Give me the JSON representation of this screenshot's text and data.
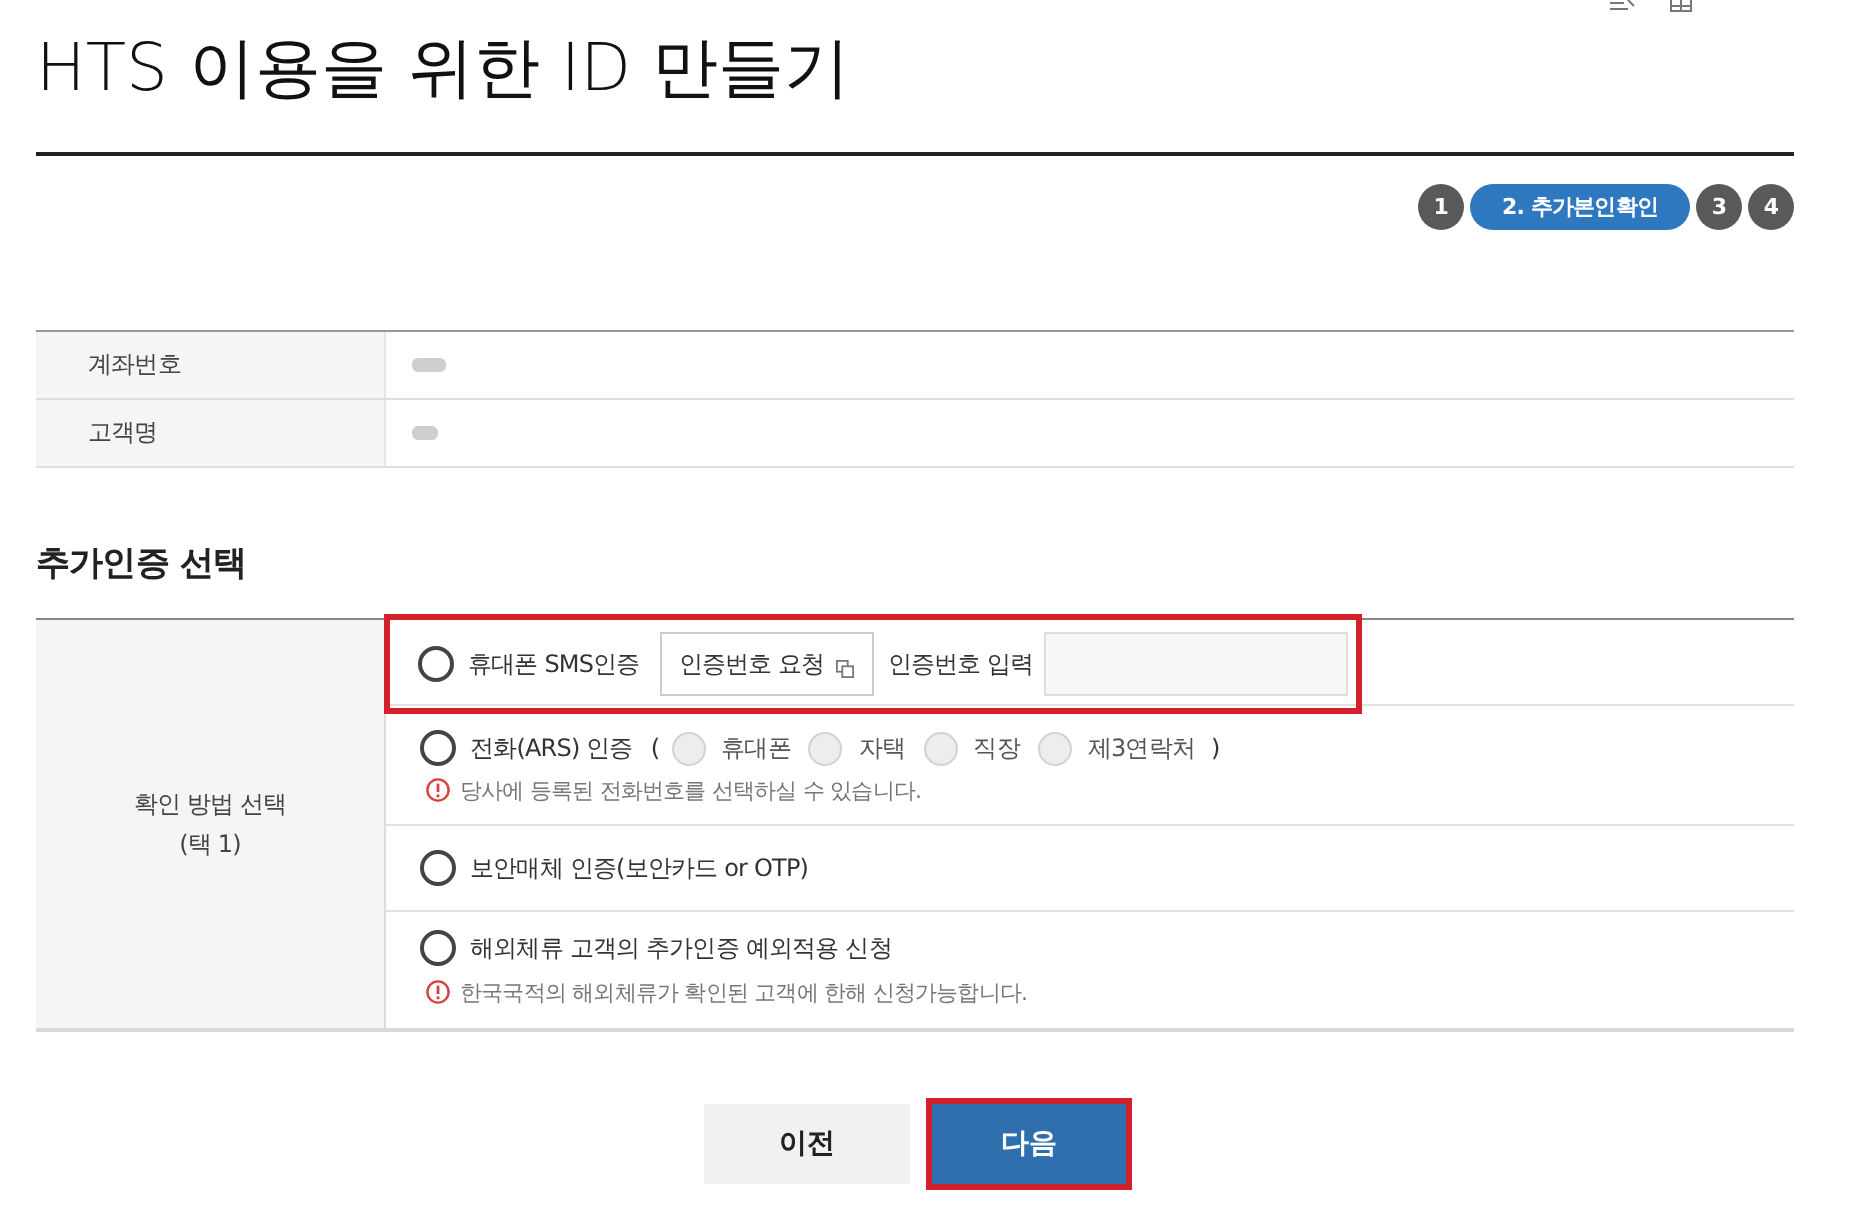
{
  "title": "HTS 이용을 위한 ID 만들기",
  "steps": [
    {
      "label": "1",
      "selected": false
    },
    {
      "label": "2. 추가본인확인",
      "selected": true
    },
    {
      "label": "3",
      "selected": false
    },
    {
      "label": "4",
      "selected": false
    }
  ],
  "account_info": {
    "rows": [
      {
        "label": "계좌번호",
        "value_redacted": true
      },
      {
        "label": "고객명",
        "value_redacted": true
      }
    ]
  },
  "section_title": "추가인증 선택",
  "method_table": {
    "label": "확인 방법 선택",
    "label_note": "(택 1)",
    "options": [
      {
        "kind": "sms",
        "label": "휴대폰 SMS인증",
        "selected": false,
        "highlighted": true,
        "request_button": "인증번호 요청",
        "input_label": "인증번호 입력"
      },
      {
        "kind": "phone",
        "label": "전화(ARS) 인증",
        "selected": false,
        "highlighted": false,
        "paren_open": "(",
        "paren_close": ")",
        "sub_options": [
          {
            "label": "휴대폰",
            "selected": false,
            "disabled": true
          },
          {
            "label": "자택",
            "selected": false,
            "disabled": true
          },
          {
            "label": "직장",
            "selected": false,
            "disabled": true
          },
          {
            "label": "제3연락처",
            "selected": false,
            "disabled": true
          }
        ],
        "note": "당사에 등록된 전화번호를 선택하실 수 있습니다."
      },
      {
        "kind": "plain",
        "label": "보안매체 인증(보안카드 or OTP)",
        "selected": false,
        "highlighted": false
      },
      {
        "kind": "plain",
        "label": "해외체류 고객의 추가인증 예외적용 신청",
        "selected": false,
        "highlighted": false,
        "note": "한국국적의 해외체류가 확인된 고객에 한해 신청가능합니다."
      }
    ]
  },
  "buttons": [
    {
      "kind": "secondary",
      "label": "이전",
      "highlighted": false
    },
    {
      "kind": "primary",
      "label": "다음",
      "highlighted": true
    }
  ]
}
